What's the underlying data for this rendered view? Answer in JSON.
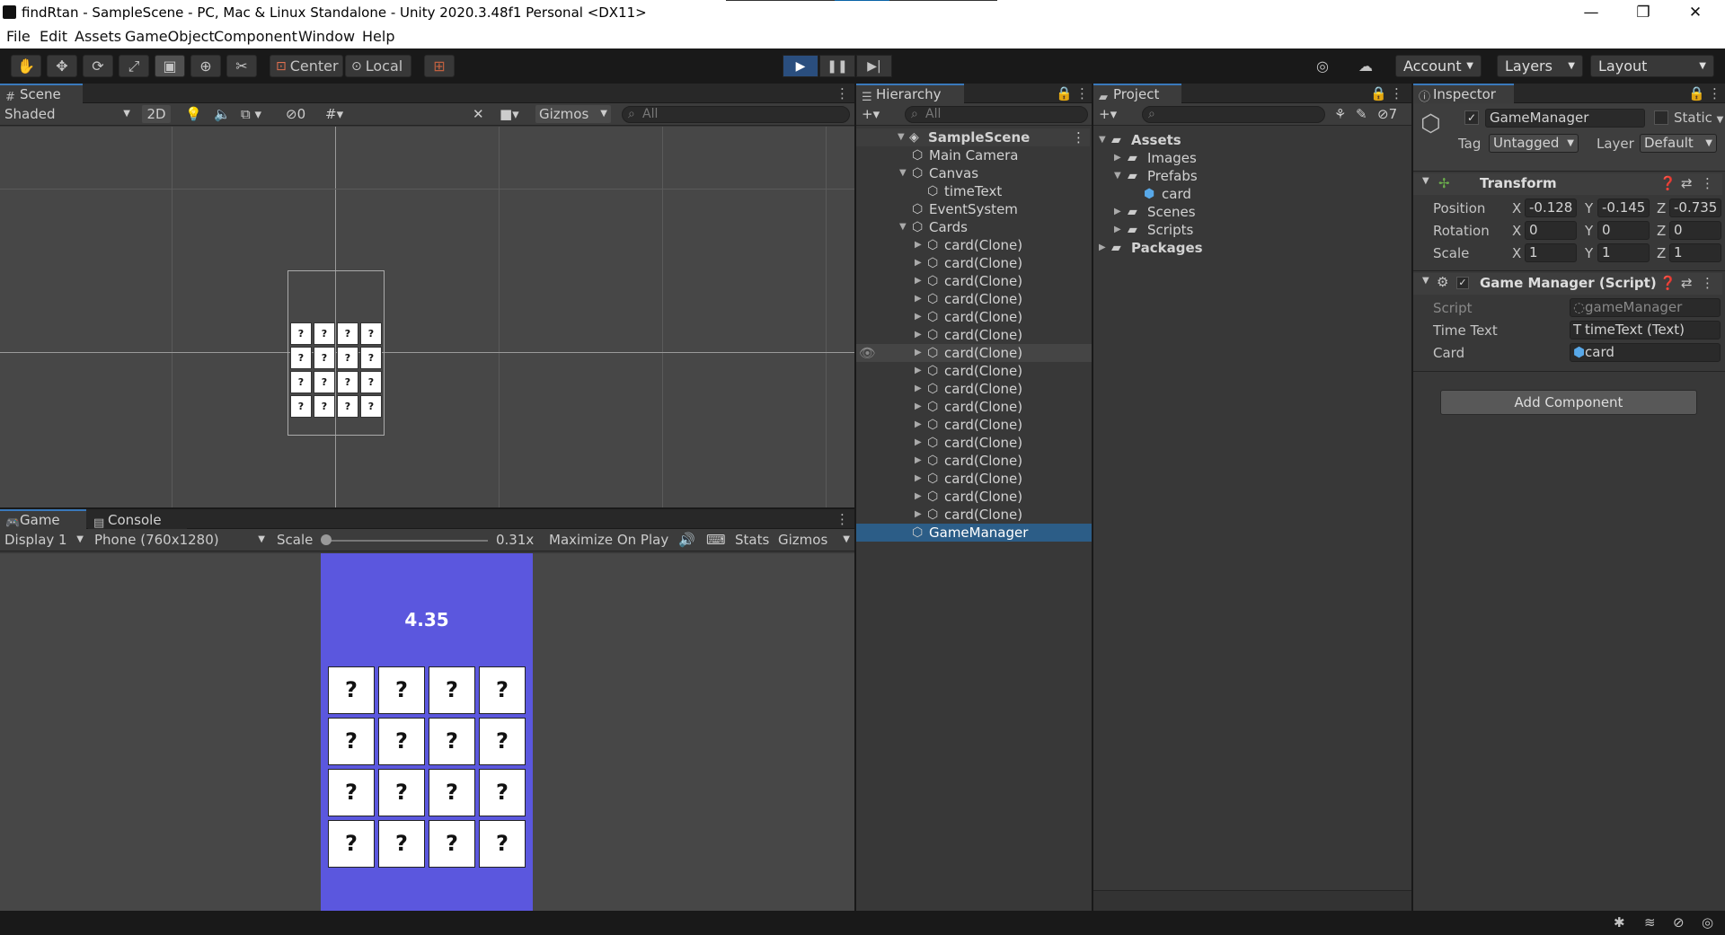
{
  "window": {
    "title": "findRtan - SampleScene - PC, Mac & Linux Standalone - Unity 2020.3.48f1 Personal <DX11>",
    "minimize": "—",
    "maximize": "❐",
    "close": "✕"
  },
  "menu": [
    "File",
    "Edit",
    "Assets",
    "GameObject",
    "Component",
    "Window",
    "Help"
  ],
  "toolbar": {
    "pivot": "Center",
    "space": "Local",
    "account": "Account",
    "layers": "Layers",
    "layout": "Layout"
  },
  "scene": {
    "tab": "Scene",
    "shading": "Shaded",
    "mode2d": "2D",
    "hidden_count": "0",
    "gizmos": "Gizmos",
    "search_placeholder": "All",
    "grid_cards": [
      "?",
      "?",
      "?",
      "?",
      "?",
      "?",
      "?",
      "?",
      "?",
      "?",
      "?",
      "?",
      "?",
      "?",
      "?",
      "?"
    ]
  },
  "game": {
    "tab": "Game",
    "console_tab": "Console",
    "display": "Display 1",
    "resolution": "Phone (760x1280)",
    "scale_label": "Scale",
    "scale_value": "0.31x",
    "maximize": "Maximize On Play",
    "stats": "Stats",
    "gizmos": "Gizmos",
    "time_text": "4.35",
    "cards": [
      "?",
      "?",
      "?",
      "?",
      "?",
      "?",
      "?",
      "?",
      "?",
      "?",
      "?",
      "?",
      "?",
      "?",
      "?",
      "?"
    ],
    "bg_color": "#5b57de"
  },
  "hierarchy": {
    "tab": "Hierarchy",
    "search_placeholder": "All",
    "scene": "SampleScene",
    "items": [
      {
        "label": "Main Camera"
      },
      {
        "label": "Canvas"
      },
      {
        "label": "timeText"
      },
      {
        "label": "EventSystem"
      },
      {
        "label": "Cards"
      },
      {
        "label": "card(Clone)"
      },
      {
        "label": "card(Clone)"
      },
      {
        "label": "card(Clone)"
      },
      {
        "label": "card(Clone)"
      },
      {
        "label": "card(Clone)"
      },
      {
        "label": "card(Clone)"
      },
      {
        "label": "card(Clone)"
      },
      {
        "label": "card(Clone)"
      },
      {
        "label": "card(Clone)"
      },
      {
        "label": "card(Clone)"
      },
      {
        "label": "card(Clone)"
      },
      {
        "label": "card(Clone)"
      },
      {
        "label": "card(Clone)"
      },
      {
        "label": "card(Clone)"
      },
      {
        "label": "card(Clone)"
      },
      {
        "label": "card(Clone)"
      },
      {
        "label": "GameManager"
      }
    ]
  },
  "project": {
    "tab": "Project",
    "hidden_count": "7",
    "items": [
      "Assets",
      "Images",
      "Prefabs",
      "card",
      "Scenes",
      "Scripts",
      "Packages"
    ]
  },
  "inspector": {
    "tab": "Inspector",
    "object_name": "GameManager",
    "static": "Static",
    "tag_label": "Tag",
    "tag_value": "Untagged",
    "layer_label": "Layer",
    "layer_value": "Default",
    "transform": {
      "title": "Transform",
      "position_label": "Position",
      "rotation_label": "Rotation",
      "scale_label": "Scale",
      "position": {
        "x": "-0.128",
        "y": "-0.145",
        "z": "-0.735"
      },
      "rotation": {
        "x": "0",
        "y": "0",
        "z": "0"
      },
      "scale": {
        "x": "1",
        "y": "1",
        "z": "1"
      }
    },
    "script_component": {
      "title": "Game Manager (Script)",
      "script_label": "Script",
      "script_value": "gameManager",
      "time_text_label": "Time Text",
      "time_text_value": "timeText (Text)",
      "card_label": "Card",
      "card_value": "card"
    },
    "add_component": "Add Component"
  },
  "axis_labels": {
    "x": "X",
    "y": "Y",
    "z": "Z"
  }
}
